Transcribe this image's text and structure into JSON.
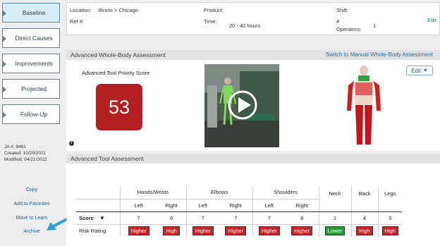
{
  "sidebar": {
    "steps": [
      {
        "label": "Baseline",
        "active": true
      },
      {
        "label": "Direct Causes",
        "active": false
      },
      {
        "label": "Improvements",
        "active": false
      },
      {
        "label": "Projected",
        "active": false
      },
      {
        "label": "Follow-Up",
        "active": false
      }
    ],
    "meta": {
      "ja": "JA #: 8461",
      "created": "Created: 10/29/2021",
      "modified": "Modified: 04/21/2022"
    },
    "links": [
      "Copy",
      "Add to Favorites",
      "Move to Learn",
      "Archive"
    ]
  },
  "header": {
    "location_label": "Location:",
    "location_value": "Illinois > Chicago",
    "product_label": "Product:",
    "shift_label": "Shift:",
    "ref_label": "Ref #:",
    "time_label": "Time:",
    "time_value": "20 - 40 hours",
    "operators_label_1": "#",
    "operators_label_2": "Operators:",
    "operators_value": "1",
    "edit_label": "Edit"
  },
  "whole_body": {
    "title": "Advanced Whole-Body Assessment",
    "switch_label": "Switch to Manual Whole-Body Assessment",
    "score_title": "Advanced Tool Priority Score",
    "score": "53",
    "edit_button": "Edit",
    "info_icon": "i"
  },
  "tool": {
    "title": "Advanced Tool Assessment",
    "groups": [
      "Hands/Wrists",
      "Elbows",
      "Shoulders",
      "Neck",
      "Back",
      "Legs"
    ],
    "sides": [
      "Left",
      "Right",
      "Left",
      "Right",
      "Left",
      "Right"
    ],
    "score_label": "Score",
    "risk_label": "Risk Rating",
    "scores": [
      "7",
      "6",
      "7",
      "7",
      "7",
      "8",
      "1",
      "4",
      "5"
    ],
    "ratings": [
      "Higher",
      "High",
      "Higher",
      "Higher",
      "Higher",
      "Higher",
      "Lower",
      "High",
      "High"
    ]
  },
  "colors": {
    "high": "#c4262b",
    "lower": "#2c9a3c",
    "score_box": "#b41f22",
    "accent_link": "#1e6fa8",
    "arrow": "#29a3d6"
  }
}
